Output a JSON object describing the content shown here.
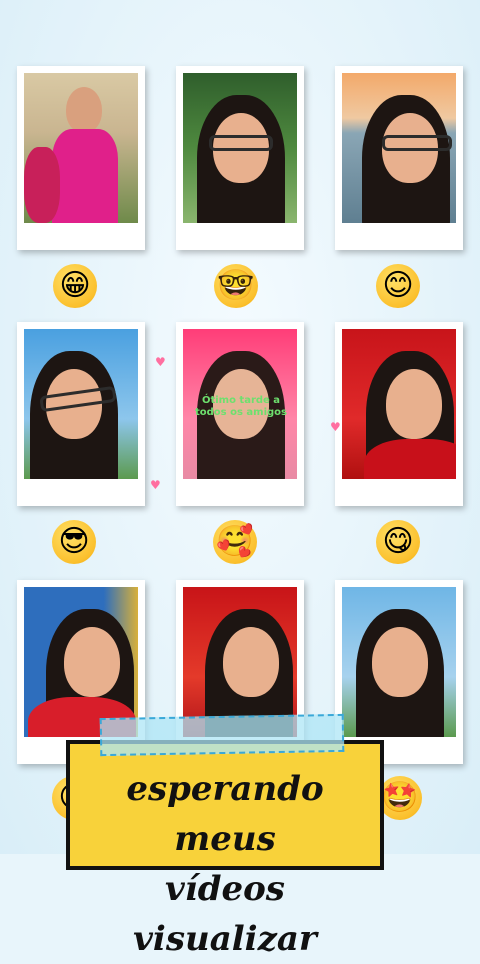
{
  "caption": {
    "line1": "esperando meus",
    "line2": "vídeos visualizar"
  },
  "overlay": {
    "text": "Ótimo tarde a todos os amigos"
  },
  "emojis": [
    {
      "name": "grinning-squinting-face-icon",
      "glyph": "😁"
    },
    {
      "name": "nerd-face-icon",
      "glyph": "🤓"
    },
    {
      "name": "smiling-face-icon",
      "glyph": "😊"
    },
    {
      "name": "cool-face-icon",
      "glyph": "😎"
    },
    {
      "name": "smiling-face-with-hearts-icon",
      "glyph": "🥰"
    },
    {
      "name": "yum-face-icon",
      "glyph": "😋"
    },
    {
      "name": "smiling-face-partial-icon",
      "glyph": "😊"
    },
    {
      "name": "star-struck-face-icon",
      "glyph": "🤩"
    }
  ],
  "colors": {
    "background": "#e8f5fb",
    "caption_bg": "#f8d23a",
    "tape": "#ade6f5"
  }
}
